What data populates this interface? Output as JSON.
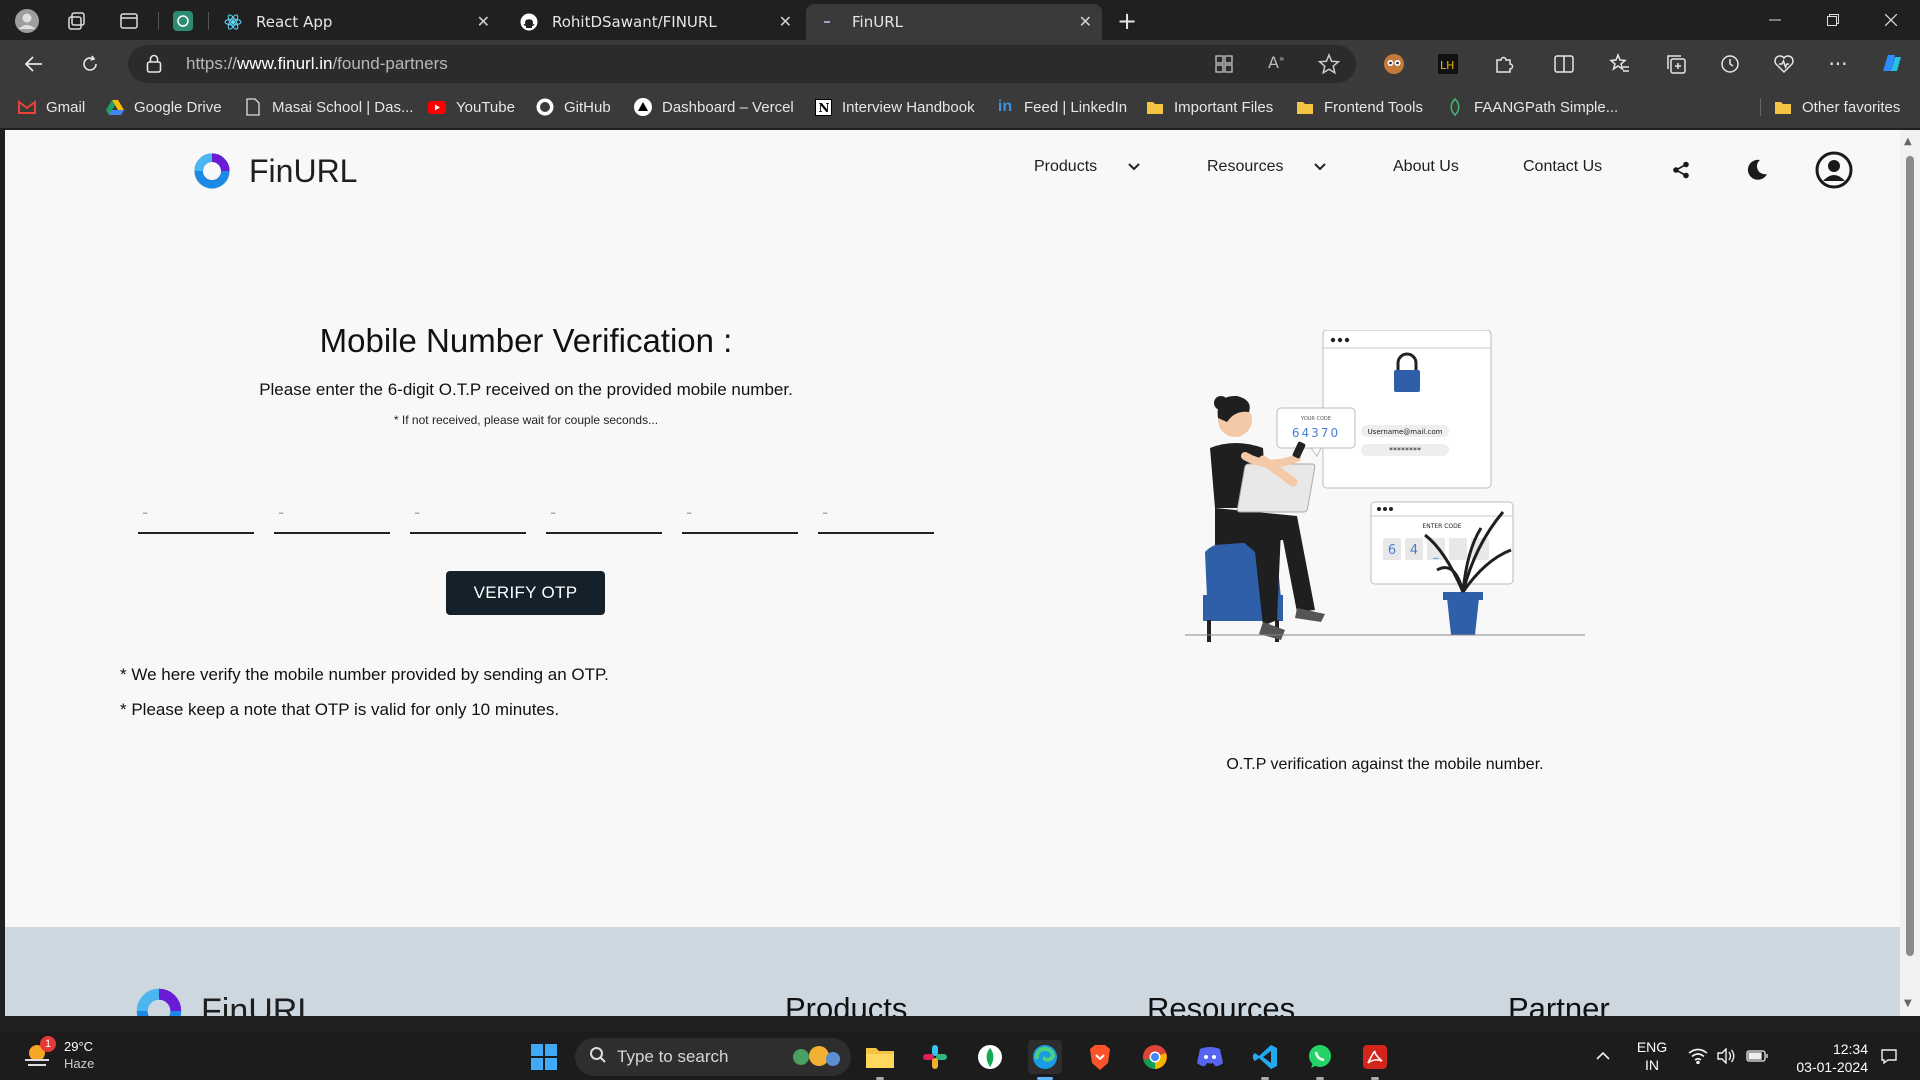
{
  "browser": {
    "tabs": [
      {
        "title": "React App",
        "favicon": "react-icon",
        "active": false
      },
      {
        "title": "RohitDSawant/FINURL",
        "favicon": "github-icon",
        "active": false
      },
      {
        "title": "FinURL",
        "favicon": "loading-icon",
        "active": true
      }
    ],
    "address": {
      "scheme": "https://",
      "host": "www.finurl.in",
      "path": "/found-partners"
    },
    "favorites": [
      {
        "label": "Gmail",
        "icon": "gmail-icon"
      },
      {
        "label": "Google Drive",
        "icon": "google-drive-icon"
      },
      {
        "label": "Masai School | Das...",
        "icon": "page-icon"
      },
      {
        "label": "YouTube",
        "icon": "youtube-icon"
      },
      {
        "label": "GitHub",
        "icon": "github-icon"
      },
      {
        "label": "Dashboard – Vercel",
        "icon": "vercel-icon"
      },
      {
        "label": "Interview Handbook",
        "icon": "notion-icon"
      },
      {
        "label": "Feed | LinkedIn",
        "icon": "linkedin-icon"
      },
      {
        "label": "Important Files",
        "icon": "folder-icon"
      },
      {
        "label": "Frontend Tools",
        "icon": "folder-icon"
      },
      {
        "label": "FAANGPath Simple...",
        "icon": "faangpath-icon"
      }
    ],
    "other_favorites": "Other favorites"
  },
  "site": {
    "brand": "FinURL",
    "nav": {
      "products": "Products",
      "resources": "Resources",
      "about": "About Us",
      "contact": "Contact Us"
    }
  },
  "otp": {
    "title": "Mobile Number Verification :",
    "subtitle": "Please enter the 6-digit O.T.P received on the provided mobile number.",
    "hint": "* If not received, please wait for couple seconds...",
    "placeholder": "-",
    "button": "VERIFY OTP",
    "notes": [
      "* We here verify the mobile number provided by sending an OTP.",
      "* Please keep a note that OTP is valid for only 10 minutes."
    ]
  },
  "illustration": {
    "caption": "O.T.P verification against the mobile number.",
    "code_label": "YOUR CODE",
    "code": "64370",
    "email": "Username@mail.com",
    "password": "********",
    "enter_code": "ENTER CODE",
    "entered": [
      "6",
      "4",
      "_"
    ]
  },
  "footer": {
    "brand": "FinURL",
    "columns": [
      "Products",
      "Resources",
      "Partner"
    ]
  },
  "taskbar": {
    "weather_temp": "29°C",
    "weather_desc": "Haze",
    "weather_badge": "1",
    "search_placeholder": "Type to search",
    "lang_top": "ENG",
    "lang_bottom": "IN",
    "time": "12:34",
    "date": "03-01-2024"
  },
  "colors": {
    "accent_blue": "#1e88e5",
    "accent_purple": "#6a1bd6",
    "button_dark": "#14212b",
    "footer_bg": "#cdd7df"
  }
}
